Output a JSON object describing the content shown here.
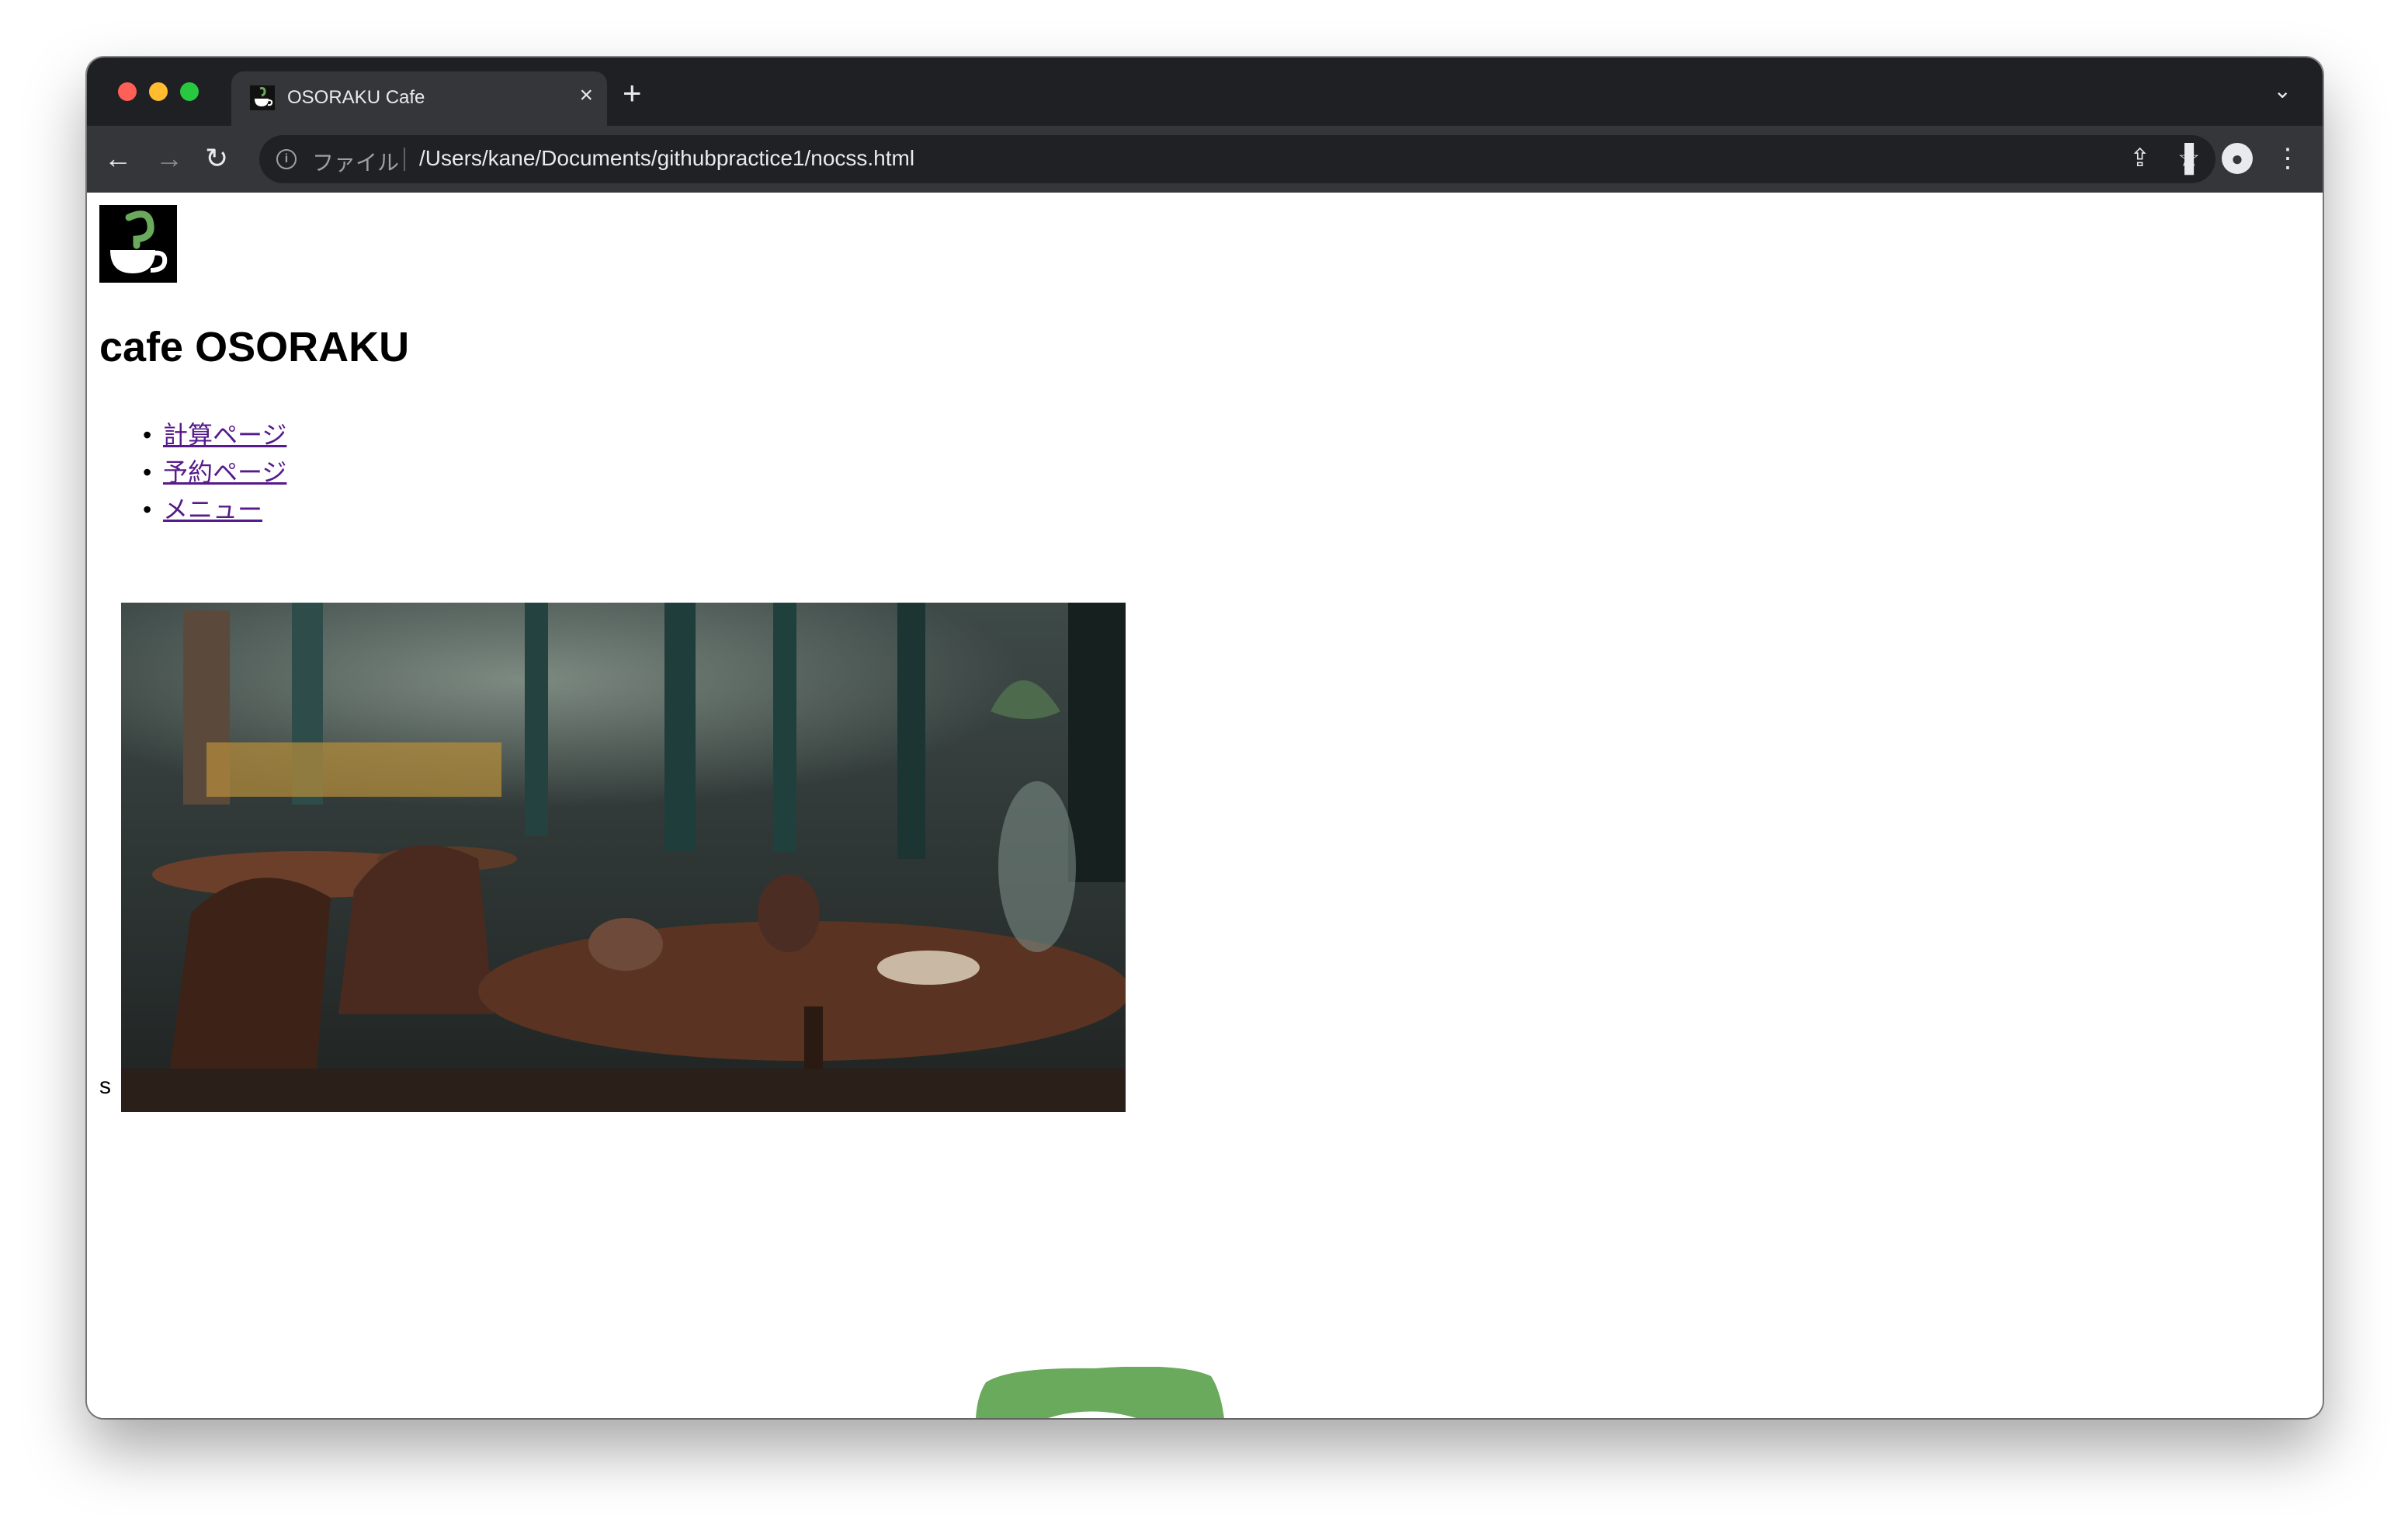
{
  "browser": {
    "tab": {
      "title": "OSORAKU Cafe",
      "favicon": "coffee-cup-icon"
    },
    "address_bar": {
      "scheme_label": "ファイル",
      "url": "/Users/kane/Documents/githubpractice1/nocss.html"
    },
    "icons": {
      "back": "←",
      "forward": "→",
      "reload": "↻",
      "share": "⇪",
      "star": "☆",
      "side_panel": "▐",
      "profile": "●",
      "menu": "⋮",
      "new_tab": "+",
      "close_tab": "×",
      "tab_dropdown": "⌄",
      "info": "i"
    }
  },
  "page": {
    "logo": "cafe-logo-icon",
    "title": "cafe OSORAKU",
    "nav": [
      {
        "label": "計算ページ"
      },
      {
        "label": "予約ページ"
      },
      {
        "label": "メニュー"
      }
    ],
    "stray_text": "s",
    "hero_image": "cafe-interior-photo"
  },
  "colors": {
    "link": "#551a8b",
    "logo_green": "#6aaa5c",
    "chrome_dark": "#1f2023",
    "chrome_toolbar": "#35363a"
  }
}
